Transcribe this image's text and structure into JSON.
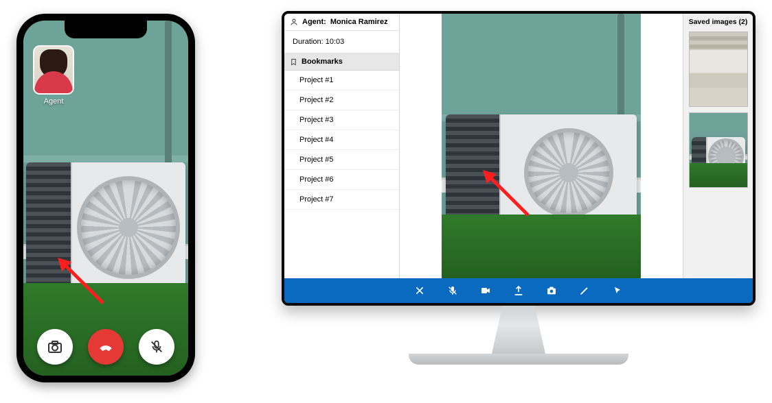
{
  "phone": {
    "agent_label": "Agent",
    "controls": {
      "camera_icon": "camera",
      "hangup_icon": "phone-hangup",
      "mic_icon": "microphone-muted"
    }
  },
  "desktop": {
    "agent_prefix": "Agent:",
    "agent_name": "Monica Ramirez",
    "duration_label": "Duration:",
    "duration_value": "10:03",
    "bookmarks_header": "Bookmarks",
    "bookmarks": [
      "Project #1",
      "Project #2",
      "Project #3",
      "Project #4",
      "Project #5",
      "Project #6",
      "Project #7"
    ],
    "saved_images_label": "Saved images (2)",
    "toolbar": {
      "close": "close",
      "mic": "microphone-muted",
      "video": "video-camera",
      "upload": "upload",
      "snapshot": "camera",
      "annotate": "pencil",
      "pointer": "cursor"
    },
    "colors": {
      "toolbar_bg": "#0a6ac0",
      "annotation_arrow": "#ff1e1e"
    }
  }
}
